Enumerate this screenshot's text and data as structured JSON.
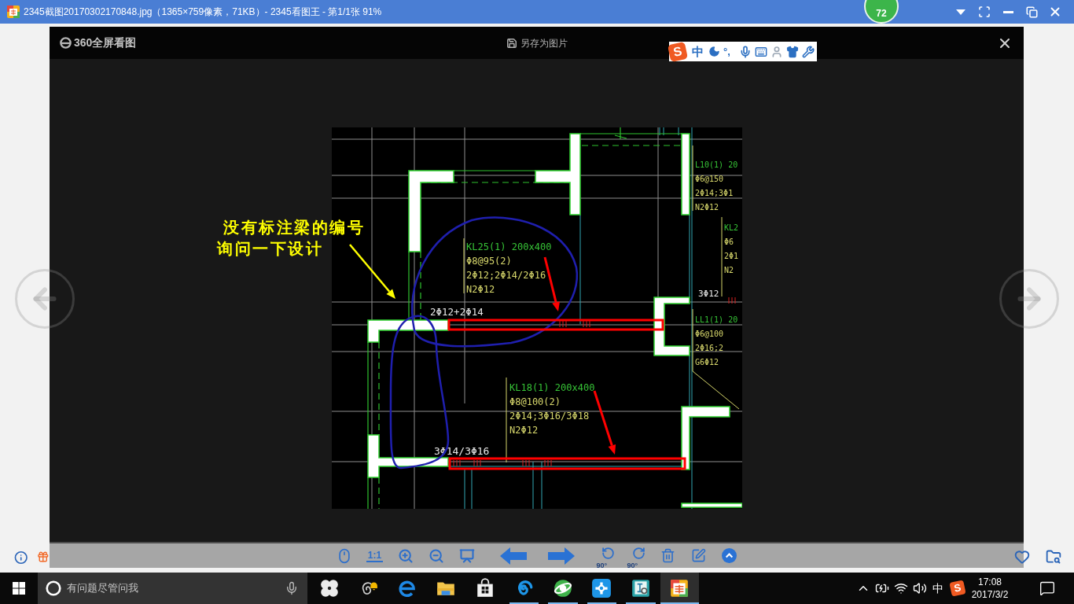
{
  "window": {
    "title": "2345截图20170302170848.jpg（1365×759像素，71KB）- 2345看图王 - 第1/1张 91%",
    "badge": "72"
  },
  "viewer": {
    "brand": "360全屏看图",
    "save_label": "另存为图片"
  },
  "ime_bar": {
    "logo_mark": "S",
    "mode": "中",
    "punctuation": "°,"
  },
  "drawing": {
    "beam_labels": [
      {
        "lines": [
          "KL25(1) 200x400",
          "Φ8@95(2)",
          "2Φ12;2Φ14/2Φ16",
          "N2Φ12"
        ]
      },
      {
        "lines": [
          "KL18(1) 200x400",
          "Φ8@100(2)",
          "2Φ14;3Φ16/3Φ18",
          "N2Φ12"
        ]
      },
      {
        "lines": [
          "L10(1) 20",
          "Φ6@150",
          "2Φ14;3Φ1",
          "N2Φ12"
        ]
      },
      {
        "lines": [
          "KL2",
          "Φ6",
          "2Φ1",
          "N2"
        ]
      },
      {
        "lines": [
          "LL1(1) 20",
          "Φ6@100",
          "2Φ16;2",
          "G6Φ12"
        ]
      }
    ],
    "rebar_notes": [
      "2Φ12+2Φ14",
      "3Φ12",
      "3Φ14/3Φ16"
    ]
  },
  "annotation": {
    "note_lines": [
      "没有标注梁的编号",
      "询问一下设计"
    ]
  },
  "toolbar": {
    "items": [
      {
        "kind": "mouse"
      },
      {
        "kind": "actual_size",
        "label": "1:1"
      },
      {
        "kind": "zoom_in"
      },
      {
        "kind": "zoom_out"
      },
      {
        "kind": "fit"
      },
      {
        "kind": "prev"
      },
      {
        "kind": "next"
      },
      {
        "kind": "rotate_left",
        "label": "90°"
      },
      {
        "kind": "rotate_right",
        "label": "90°"
      },
      {
        "kind": "delete"
      },
      {
        "kind": "edit"
      },
      {
        "kind": "more"
      }
    ]
  },
  "taskbar": {
    "search_placeholder": "有问题尽管问我",
    "apps": [
      {
        "kind": "pinwheel",
        "running": false,
        "selected": false
      },
      {
        "kind": "swirl_bell",
        "running": false,
        "selected": false
      },
      {
        "kind": "edge",
        "running": false,
        "selected": false
      },
      {
        "kind": "folder",
        "running": false,
        "selected": false
      },
      {
        "kind": "store",
        "running": false,
        "selected": false
      },
      {
        "kind": "blue_swirl",
        "running": true,
        "selected": false
      },
      {
        "kind": "green_globe",
        "running": true,
        "selected": false
      },
      {
        "kind": "blue_cross",
        "running": true,
        "selected": false
      },
      {
        "kind": "book",
        "running": true,
        "selected": false
      },
      {
        "kind": "viewer",
        "running": true,
        "selected": true
      }
    ],
    "tray": {
      "ime": "中",
      "logo_mark": "S",
      "time": "17:08",
      "date": "2017/3/2"
    }
  }
}
